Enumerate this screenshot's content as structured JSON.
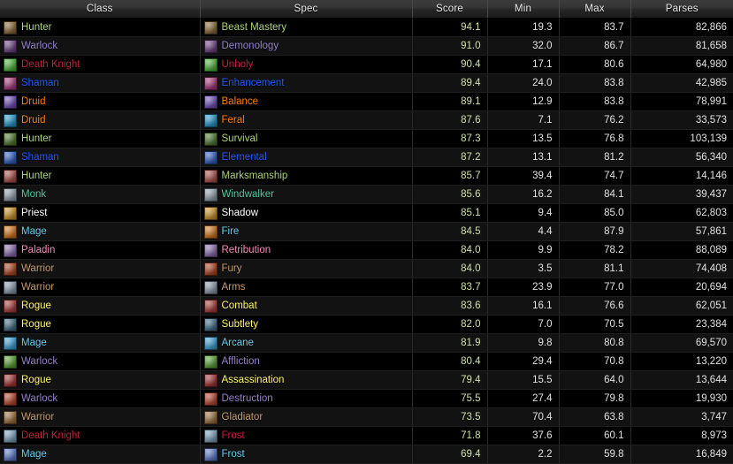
{
  "table": {
    "columns": [
      {
        "key": "class",
        "label": "Class",
        "align": "center"
      },
      {
        "key": "spec",
        "label": "Spec",
        "align": "center"
      },
      {
        "key": "score",
        "label": "Score",
        "align": "center"
      },
      {
        "key": "min",
        "label": "Min",
        "align": "center"
      },
      {
        "key": "max",
        "label": "Max",
        "align": "center"
      },
      {
        "key": "parses",
        "label": "Parses",
        "align": "center"
      }
    ],
    "class_colors": {
      "Hunter": "#ABD473",
      "Warlock": "#9482C9",
      "Death Knight": "#C41F3B",
      "Shaman": "#2459FF",
      "Druid": "#FF7D0A",
      "Monk": "#52C9A3",
      "Priest": "#FFFFFF",
      "Mage": "#69CCF0",
      "Paladin": "#F58CBA",
      "Warrior": "#C79C6E",
      "Rogue": "#FFF569"
    },
    "icon_colors": {
      "Beast Mastery": "#8b6a33",
      "Demonology": "#6b3f86",
      "Unholy": "#4fbf3a",
      "Enhancement": "#b0357e",
      "Balance": "#6f4fc0",
      "Feral": "#1f9fd6",
      "Survival": "#4e7a2c",
      "Elemental": "#2f5fd0",
      "Marksmanship": "#b2504a",
      "Windwalker": "#9aa7b5",
      "Shadow": "#d79a21",
      "Fire": "#e07a18",
      "Retribution": "#8e6fb5",
      "Fury": "#b7431d",
      "Arms": "#8fa0b3",
      "Combat": "#b23a36",
      "Subtlety": "#3f6d8c",
      "Arcane": "#3aa8e0",
      "Affliction": "#5aa832",
      "Assassination": "#a82f2f",
      "Destruction": "#c0452a",
      "Gladiator": "#a3703c",
      "Frost DK": "#7fa8c9",
      "Frost Mage": "#5f7fd6"
    },
    "rows": [
      {
        "class": "Hunter",
        "spec": "Beast Mastery",
        "icon": "Beast Mastery",
        "score": "94.1",
        "min": "19.3",
        "max": "83.7",
        "parses": "82,866"
      },
      {
        "class": "Warlock",
        "spec": "Demonology",
        "icon": "Demonology",
        "score": "91.0",
        "min": "32.0",
        "max": "86.7",
        "parses": "81,658"
      },
      {
        "class": "Death Knight",
        "spec": "Unholy",
        "icon": "Unholy",
        "score": "90.4",
        "min": "17.1",
        "max": "80.6",
        "parses": "64,980"
      },
      {
        "class": "Shaman",
        "spec": "Enhancement",
        "icon": "Enhancement",
        "score": "89.4",
        "min": "24.0",
        "max": "83.8",
        "parses": "42,985"
      },
      {
        "class": "Druid",
        "spec": "Balance",
        "icon": "Balance",
        "score": "89.1",
        "min": "12.9",
        "max": "83.8",
        "parses": "78,991"
      },
      {
        "class": "Druid",
        "spec": "Feral",
        "icon": "Feral",
        "score": "87.6",
        "min": "7.1",
        "max": "76.2",
        "parses": "33,573"
      },
      {
        "class": "Hunter",
        "spec": "Survival",
        "icon": "Survival",
        "score": "87.3",
        "min": "13.5",
        "max": "76.8",
        "parses": "103,139"
      },
      {
        "class": "Shaman",
        "spec": "Elemental",
        "icon": "Elemental",
        "score": "87.2",
        "min": "13.1",
        "max": "81.2",
        "parses": "56,340"
      },
      {
        "class": "Hunter",
        "spec": "Marksmanship",
        "icon": "Marksmanship",
        "score": "85.7",
        "min": "39.4",
        "max": "74.7",
        "parses": "14,146"
      },
      {
        "class": "Monk",
        "spec": "Windwalker",
        "icon": "Windwalker",
        "score": "85.6",
        "min": "16.2",
        "max": "84.1",
        "parses": "39,437"
      },
      {
        "class": "Priest",
        "spec": "Shadow",
        "icon": "Shadow",
        "score": "85.1",
        "min": "9.4",
        "max": "85.0",
        "parses": "62,803"
      },
      {
        "class": "Mage",
        "spec": "Fire",
        "icon": "Fire",
        "score": "84.5",
        "min": "4.4",
        "max": "87.9",
        "parses": "57,861"
      },
      {
        "class": "Paladin",
        "spec": "Retribution",
        "icon": "Retribution",
        "score": "84.0",
        "min": "9.9",
        "max": "78.2",
        "parses": "88,089"
      },
      {
        "class": "Warrior",
        "spec": "Fury",
        "icon": "Fury",
        "score": "84.0",
        "min": "3.5",
        "max": "81.1",
        "parses": "74,408"
      },
      {
        "class": "Warrior",
        "spec": "Arms",
        "icon": "Arms",
        "score": "83.7",
        "min": "23.9",
        "max": "77.0",
        "parses": "20,694"
      },
      {
        "class": "Rogue",
        "spec": "Combat",
        "icon": "Combat",
        "score": "83.6",
        "min": "16.1",
        "max": "76.6",
        "parses": "62,051"
      },
      {
        "class": "Rogue",
        "spec": "Subtlety",
        "icon": "Subtlety",
        "score": "82.0",
        "min": "7.0",
        "max": "70.5",
        "parses": "23,384"
      },
      {
        "class": "Mage",
        "spec": "Arcane",
        "icon": "Arcane",
        "score": "81.9",
        "min": "9.8",
        "max": "80.8",
        "parses": "69,570"
      },
      {
        "class": "Warlock",
        "spec": "Affliction",
        "icon": "Affliction",
        "score": "80.4",
        "min": "29.4",
        "max": "70.8",
        "parses": "13,220"
      },
      {
        "class": "Rogue",
        "spec": "Assassination",
        "icon": "Assassination",
        "score": "79.4",
        "min": "15.5",
        "max": "64.0",
        "parses": "13,644"
      },
      {
        "class": "Warlock",
        "spec": "Destruction",
        "icon": "Destruction",
        "score": "75.5",
        "min": "27.4",
        "max": "79.8",
        "parses": "19,930"
      },
      {
        "class": "Warrior",
        "spec": "Gladiator",
        "icon": "Gladiator",
        "score": "73.5",
        "min": "70.4",
        "max": "63.8",
        "parses": "3,747"
      },
      {
        "class": "Death Knight",
        "spec": "Frost",
        "icon": "Frost DK",
        "score": "71.8",
        "min": "37.6",
        "max": "60.1",
        "parses": "8,973"
      },
      {
        "class": "Mage",
        "spec": "Frost",
        "icon": "Frost Mage",
        "score": "69.4",
        "min": "2.2",
        "max": "59.8",
        "parses": "16,849"
      }
    ]
  }
}
